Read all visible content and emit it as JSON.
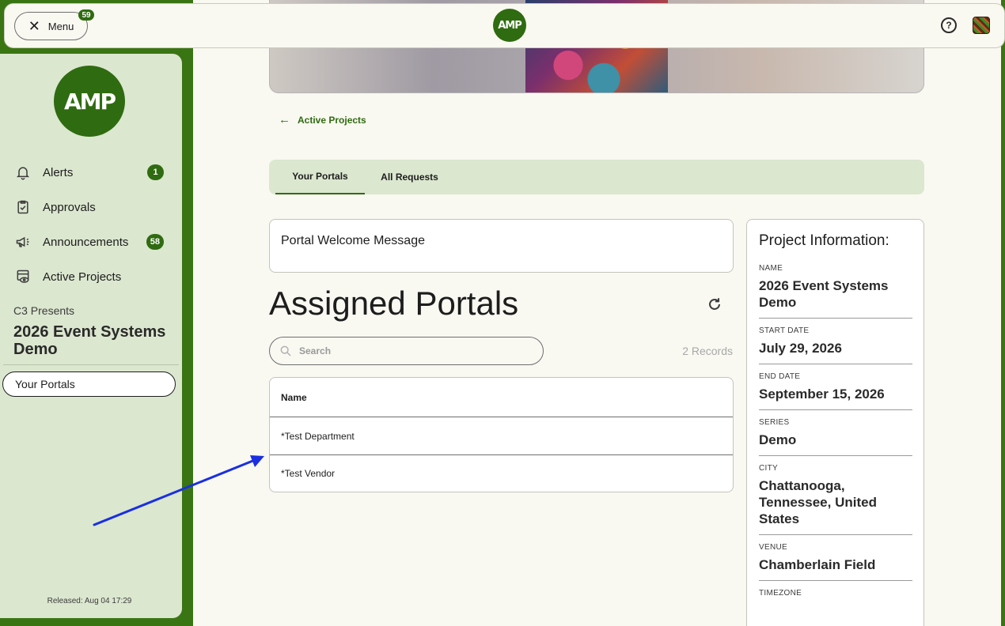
{
  "topbar": {
    "menu_label": "Menu",
    "menu_badge": "59",
    "logo_text": "AMP",
    "help_glyph": "?"
  },
  "sidebar": {
    "logo_text": "AMP",
    "items": [
      {
        "label": "Alerts",
        "icon": "bell-icon",
        "badge": "1"
      },
      {
        "label": "Approvals",
        "icon": "clipboard-check-icon",
        "badge": ""
      },
      {
        "label": "Announcements",
        "icon": "megaphone-icon",
        "badge": "58"
      },
      {
        "label": "Active Projects",
        "icon": "project-eye-icon",
        "badge": ""
      }
    ],
    "presenter": "C3 Presents",
    "project_name": "2026 Event Systems Demo",
    "active_item": "Your Portals",
    "released": "Released: Aug 04 17:29"
  },
  "main": {
    "back_label": "Active Projects",
    "tabs": [
      {
        "label": "Your Portals",
        "active": true
      },
      {
        "label": "All Requests",
        "active": false
      }
    ],
    "welcome": "Portal Welcome Message",
    "title": "Assigned Portals",
    "search_placeholder": "Search",
    "records": "2 Records",
    "table": {
      "header": "Name",
      "rows": [
        "*Test Department",
        "*Test Vendor"
      ]
    }
  },
  "project_info": {
    "title": "Project Information:",
    "fields": [
      {
        "label": "NAME",
        "value": "2026 Event Systems Demo"
      },
      {
        "label": "START DATE",
        "value": "July 29, 2026"
      },
      {
        "label": "END DATE",
        "value": "September 15, 2026"
      },
      {
        "label": "SERIES",
        "value": "Demo"
      },
      {
        "label": "CITY",
        "value": "Chattanooga, Tennessee, United States"
      },
      {
        "label": "VENUE",
        "value": "Chamberlain Field"
      },
      {
        "label": "TIMEZONE",
        "value": ""
      }
    ]
  },
  "colors": {
    "brand_green": "#2f6b10",
    "sidebar_bg": "#dbe7cf",
    "canvas_bg": "#f9f8f1",
    "annotation_arrow": "#1a2fe0"
  }
}
